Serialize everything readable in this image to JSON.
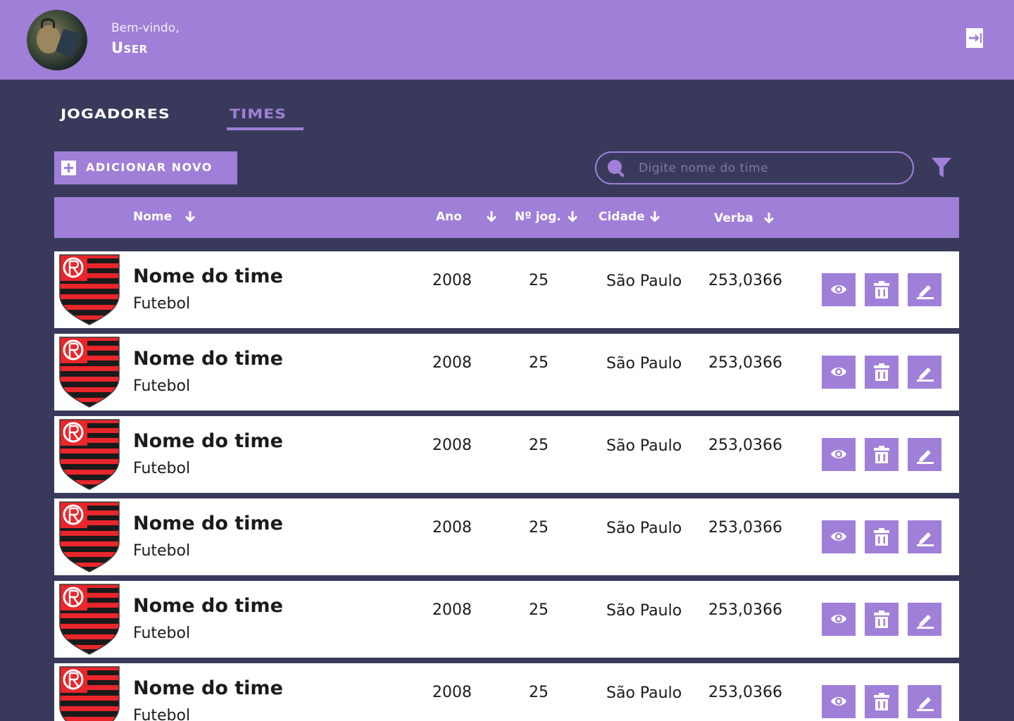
{
  "header": {
    "welcome": "Bem-vindo,",
    "username": "User"
  },
  "tabs": [
    {
      "label": "JOGADORES",
      "active": false
    },
    {
      "label": "TIMES",
      "active": true
    }
  ],
  "toolbar": {
    "add_label": "ADICIONAR NOVO",
    "search_placeholder": "Digite nome do time",
    "search_value": ""
  },
  "table": {
    "columns": [
      "Nome",
      "Ano",
      "Nº jog.",
      "Cidade",
      "Verba"
    ],
    "rows": [
      {
        "name": "Nome do time",
        "sport": "Futebol",
        "year": "2008",
        "players": "25",
        "city": "São Paulo",
        "budget": "253,0366"
      },
      {
        "name": "Nome do time",
        "sport": "Futebol",
        "year": "2008",
        "players": "25",
        "city": "São Paulo",
        "budget": "253,0366"
      },
      {
        "name": "Nome do time",
        "sport": "Futebol",
        "year": "2008",
        "players": "25",
        "city": "São Paulo",
        "budget": "253,0366"
      },
      {
        "name": "Nome do time",
        "sport": "Futebol",
        "year": "2008",
        "players": "25",
        "city": "São Paulo",
        "budget": "253,0366"
      },
      {
        "name": "Nome do time",
        "sport": "Futebol",
        "year": "2008",
        "players": "25",
        "city": "São Paulo",
        "budget": "253,0366"
      },
      {
        "name": "Nome do time",
        "sport": "Futebol",
        "year": "2008",
        "players": "25",
        "city": "São Paulo",
        "budget": "253,0366"
      }
    ]
  },
  "icons": {
    "logout": "logout-icon",
    "search": "search-icon",
    "filter": "filter-icon",
    "sort": "arrow-down-icon",
    "view": "eye-icon",
    "delete": "trash-icon",
    "edit": "pencil-icon",
    "crest": "team-crest-icon"
  },
  "colors": {
    "accent": "#a07fd8",
    "background": "#393a5b",
    "row_background": "#ffffff",
    "crest_red": "#e8262b",
    "crest_black": "#1a1a1a"
  }
}
